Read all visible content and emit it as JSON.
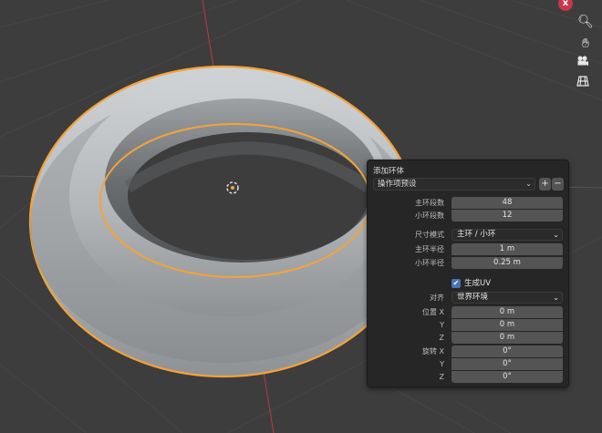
{
  "viewport": {
    "navigation": {
      "close_icon": "x-circle-icon",
      "zoom_icon": "magnify-icon",
      "pan_icon": "hand-icon",
      "camera_icon": "camera-icon",
      "grid_icon": "perspective-grid-icon"
    },
    "colors": {
      "background": "#3d3d3d",
      "selection_outline": "#f5a23a",
      "torus": "#b9bdbf"
    }
  },
  "panel": {
    "title": "添加环体",
    "preset": {
      "value": "操作项预设",
      "add_label": "+",
      "remove_label": "−"
    },
    "major_segments": {
      "label": "主环段数",
      "value": "48"
    },
    "minor_segments": {
      "label": "小环段数",
      "value": "12"
    },
    "dimensions_mode": {
      "label": "尺寸模式",
      "value": "主环 / 小环"
    },
    "major_radius": {
      "label": "主环半径",
      "value": "1 m"
    },
    "minor_radius": {
      "label": "小环半径",
      "value": "0.25 m"
    },
    "generate_uv": {
      "label": "生成UV",
      "checked": true
    },
    "align": {
      "label": "对齐",
      "value": "世界环境"
    },
    "location": {
      "label_x": "位置 X",
      "label_y": "Y",
      "label_z": "Z",
      "x": "0 m",
      "y": "0 m",
      "z": "0 m"
    },
    "rotation": {
      "label_x": "旋转 X",
      "label_y": "Y",
      "label_z": "Z",
      "x": "0°",
      "y": "0°",
      "z": "0°"
    }
  }
}
